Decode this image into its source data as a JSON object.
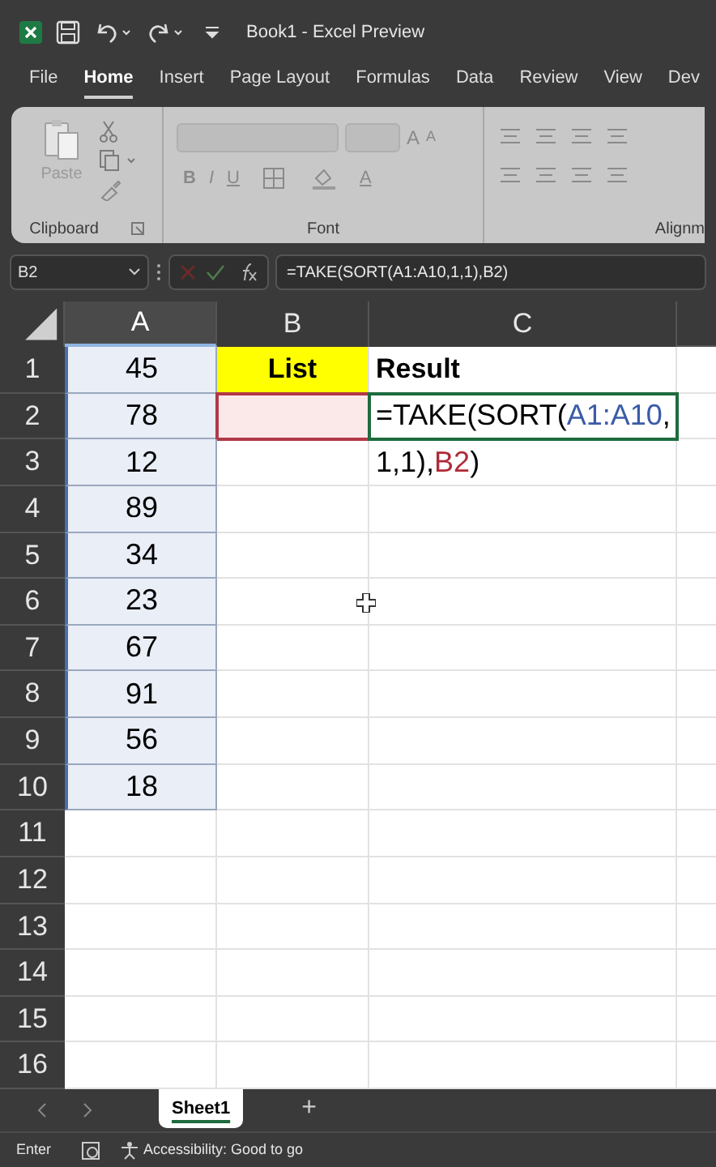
{
  "window": {
    "title": "Book1 - Excel Preview"
  },
  "ribbon_tabs": [
    {
      "label": "File",
      "selected": false
    },
    {
      "label": "Home",
      "selected": true
    },
    {
      "label": "Insert",
      "selected": false
    },
    {
      "label": "Page Layout",
      "selected": false
    },
    {
      "label": "Formulas",
      "selected": false
    },
    {
      "label": "Data",
      "selected": false
    },
    {
      "label": "Review",
      "selected": false
    },
    {
      "label": "View",
      "selected": false
    },
    {
      "label": "Dev",
      "selected": false
    }
  ],
  "ribbon": {
    "paste_label": "Paste",
    "font_buttons": [
      "B",
      "I",
      "U"
    ],
    "grow_font": "A",
    "shrink_font": "A",
    "font_color": "A",
    "groups": [
      "Clipboard",
      "Font",
      "Alignm"
    ]
  },
  "formula_bar": {
    "name_box": "B2",
    "formula": "=TAKE(SORT(A1:A10,1,1),B2)"
  },
  "columns": [
    {
      "label": "A",
      "selected": true
    },
    {
      "label": "B",
      "selected": false
    },
    {
      "label": "C",
      "selected": false
    }
  ],
  "rows": [
    {
      "label": "1",
      "a": "45",
      "b": "List",
      "c": "Result"
    },
    {
      "label": "2",
      "a": "78"
    },
    {
      "label": "3",
      "a": "12"
    },
    {
      "label": "4",
      "a": "89"
    },
    {
      "label": "5",
      "a": "34"
    },
    {
      "label": "6",
      "a": "23"
    },
    {
      "label": "7",
      "a": "67"
    },
    {
      "label": "8",
      "a": "91"
    },
    {
      "label": "9",
      "a": "56"
    },
    {
      "label": "10",
      "a": "18"
    },
    {
      "label": "11"
    },
    {
      "label": "12"
    },
    {
      "label": "13"
    },
    {
      "label": "14"
    },
    {
      "label": "15"
    },
    {
      "label": "16"
    }
  ],
  "editing_cell": {
    "lines": [
      [
        {
          "text": "=TAKE(SORT(",
          "color": "#000000"
        },
        {
          "text": "A1:A10",
          "color": "#3b5ba8"
        },
        {
          "text": ",",
          "color": "#000000"
        }
      ],
      [
        {
          "text": "1,1),",
          "color": "#000000"
        },
        {
          "text": "B2",
          "color": "#b02a37"
        },
        {
          "text": ")",
          "color": "#000000"
        }
      ]
    ]
  },
  "sheet_tabs": [
    {
      "label": "Sheet1",
      "selected": true
    }
  ],
  "add_sheet": "+",
  "status_bar": {
    "mode": "Enter",
    "accessibility": "Accessibility: Good to go"
  }
}
